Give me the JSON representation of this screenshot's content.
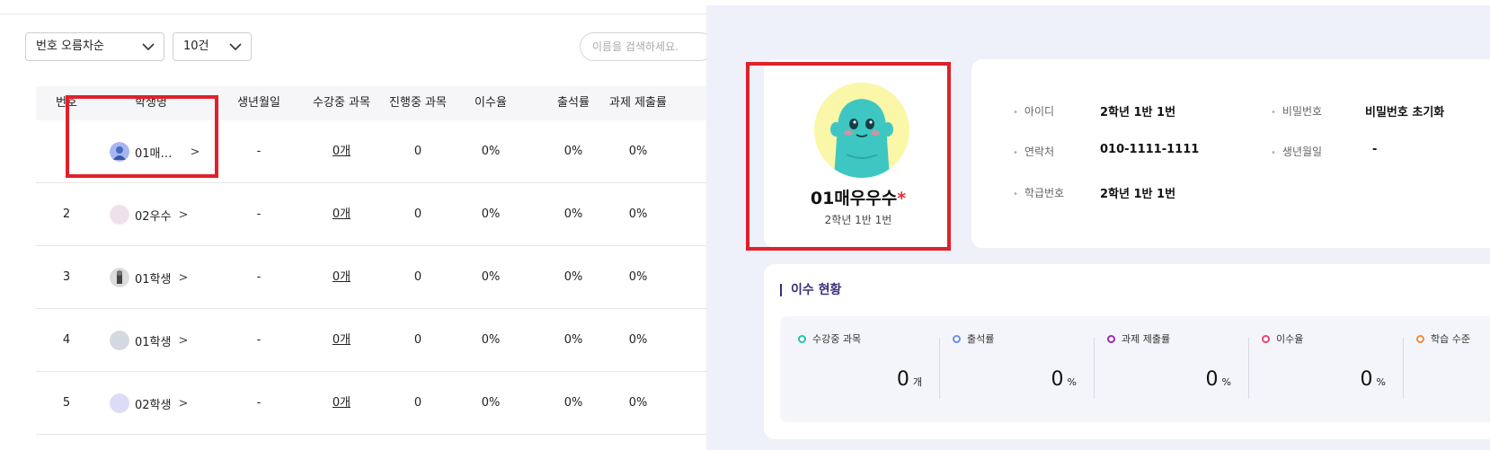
{
  "toolbar": {
    "sort_select": "번호 오름차순",
    "count_select": "10건",
    "search_placeholder": "이름을 검색하세요."
  },
  "table": {
    "headers": [
      "번호",
      "학생명",
      "생년월일",
      "수강중 과목",
      "진행중 과목",
      "이수율",
      "출석률",
      "과제 제출률"
    ],
    "rows": [
      {
        "no": "",
        "name": "01매…",
        "birth": "-",
        "courses": "0개",
        "ongoing": "0",
        "completion": "0%",
        "attendance": "0%",
        "assignment": "0%"
      },
      {
        "no": "2",
        "name": "02우수",
        "birth": "-",
        "courses": "0개",
        "ongoing": "0",
        "completion": "0%",
        "attendance": "0%",
        "assignment": "0%"
      },
      {
        "no": "3",
        "name": "01학생",
        "birth": "-",
        "courses": "0개",
        "ongoing": "0",
        "completion": "0%",
        "attendance": "0%",
        "assignment": "0%"
      },
      {
        "no": "4",
        "name": "01학생",
        "birth": "-",
        "courses": "0개",
        "ongoing": "0",
        "completion": "0%",
        "attendance": "0%",
        "assignment": "0%"
      },
      {
        "no": "5",
        "name": "02학생",
        "birth": "-",
        "courses": "0개",
        "ongoing": "0",
        "completion": "0%",
        "attendance": "0%",
        "assignment": "0%"
      }
    ],
    "chevron": ">"
  },
  "profile": {
    "name": "01매우우수",
    "required_mark": "*",
    "class": "2학년 1반 1번"
  },
  "info": {
    "id_label": "아이디",
    "id_value": "2학년 1반 1번",
    "password_label": "비밀번호",
    "password_value": "비밀번호 초기화",
    "contact_label": "연락처",
    "contact_value": "010-1111-1111",
    "birth_label": "생년월일",
    "birth_value": "-",
    "grade_label": "학급번호",
    "grade_value": "2학년 1반 1번"
  },
  "status": {
    "title": "이수 현황",
    "items": [
      {
        "label": "수강중 과목",
        "value": "0",
        "unit": "개",
        "color": "#1fc7a8"
      },
      {
        "label": "출석률",
        "value": "0",
        "unit": "%",
        "color": "#6b8fe8"
      },
      {
        "label": "과제 제출률",
        "value": "0",
        "unit": "%",
        "color": "#9b2bb8"
      },
      {
        "label": "이수율",
        "value": "0",
        "unit": "%",
        "color": "#e8466a"
      },
      {
        "label": "학습 수준",
        "value": "",
        "unit": "",
        "color": "#f08a3a"
      }
    ]
  },
  "colors": {
    "highlight": "#e0202a",
    "right_bg": "#eef0fa",
    "accent_title": "#3b2e7a"
  }
}
